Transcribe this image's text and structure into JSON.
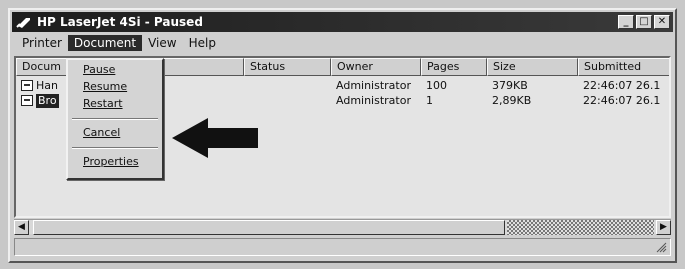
{
  "window": {
    "title": "HP LaserJet 4Si - Paused",
    "controls": {
      "minimize": "_",
      "maximize": "□",
      "close": "✕"
    }
  },
  "menubar": {
    "items": [
      {
        "label": "Printer"
      },
      {
        "label": "Document",
        "active": true
      },
      {
        "label": "View"
      },
      {
        "label": "Help"
      }
    ]
  },
  "list": {
    "columns": [
      "Docum",
      "Status",
      "Owner",
      "Pages",
      "Size",
      "Submitted"
    ],
    "rows": [
      {
        "document": "Han",
        "status": "",
        "owner": "Administrator",
        "pages": "100",
        "size": "379KB",
        "submitted": "22:46:07 26.1",
        "selected": false
      },
      {
        "document": "Bro",
        "status": "",
        "owner": "Administrator",
        "pages": "1",
        "size": "2,89KB",
        "submitted": "22:46:07 26.1",
        "selected": true
      }
    ]
  },
  "document_menu": {
    "items": [
      "Pause",
      "Resume",
      "Restart",
      "Cancel",
      "Properties"
    ]
  },
  "scrollbar": {
    "left_arrow": "◀",
    "right_arrow": "▶"
  },
  "annotation": {
    "icon": "left-arrow-icon",
    "color": "#111111"
  }
}
